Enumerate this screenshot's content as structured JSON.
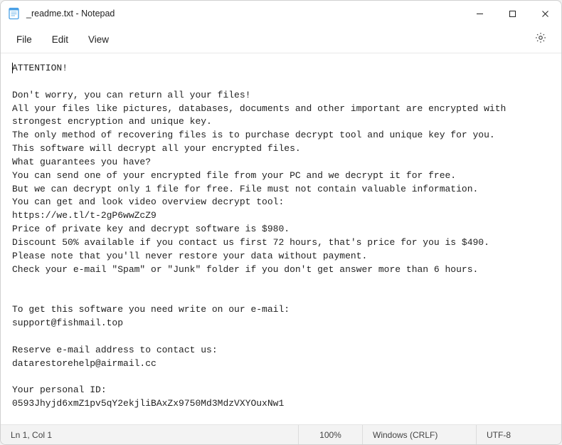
{
  "window": {
    "title": "_readme.txt - Notepad"
  },
  "menu": {
    "file": "File",
    "edit": "Edit",
    "view": "View"
  },
  "content": {
    "lines": [
      "ATTENTION!",
      "",
      "Don't worry, you can return all your files!",
      "All your files like pictures, databases, documents and other important are encrypted with strongest encryption and unique key.",
      "The only method of recovering files is to purchase decrypt tool and unique key for you.",
      "This software will decrypt all your encrypted files.",
      "What guarantees you have?",
      "You can send one of your encrypted file from your PC and we decrypt it for free.",
      "But we can decrypt only 1 file for free. File must not contain valuable information.",
      "You can get and look video overview decrypt tool:",
      "https://we.tl/t-2gP6wwZcZ9",
      "Price of private key and decrypt software is $980.",
      "Discount 50% available if you contact us first 72 hours, that's price for you is $490.",
      "Please note that you'll never restore your data without payment.",
      "Check your e-mail \"Spam\" or \"Junk\" folder if you don't get answer more than 6 hours.",
      "",
      "",
      "To get this software you need write on our e-mail:",
      "support@fishmail.top",
      "",
      "Reserve e-mail address to contact us:",
      "datarestorehelp@airmail.cc",
      "",
      "Your personal ID:",
      "0593Jhyjd6xmZ1pv5qY2ekjliBAxZx9750Md3MdzVXYOuxNw1"
    ]
  },
  "status": {
    "position": "Ln 1, Col 1",
    "zoom": "100%",
    "line_ending": "Windows (CRLF)",
    "encoding": "UTF-8"
  }
}
